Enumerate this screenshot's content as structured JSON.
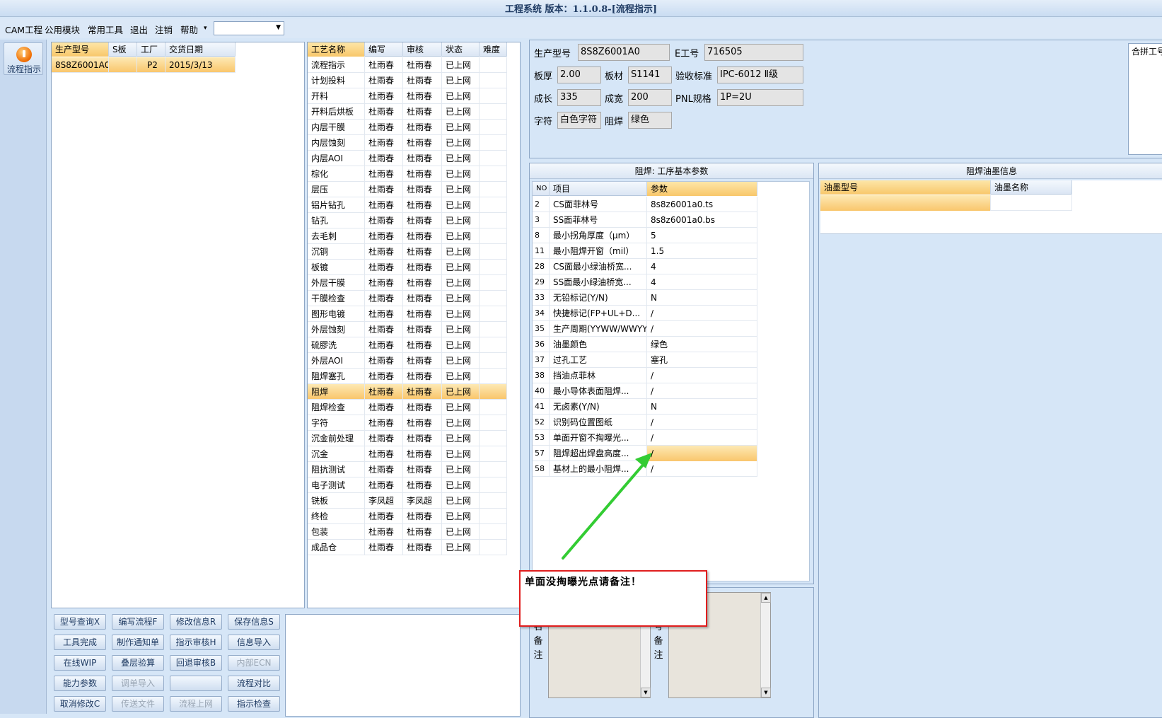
{
  "window": {
    "title": "工程系统 版本：1.1.0.8-[流程指示]"
  },
  "menu": {
    "items": [
      "CAM工程",
      "公用模块",
      "常用工具",
      "退出",
      "注销",
      "帮助",
      "▾"
    ],
    "combo_value": ""
  },
  "sidebar": {
    "flow_label": "流程指示"
  },
  "orders": {
    "headers": [
      "生产型号",
      "S板",
      "工厂",
      "交货日期"
    ],
    "rows": [
      {
        "model": "8S8Z6001A0",
        "s_board": "",
        "factory": "P2",
        "date": "2015/3/13"
      }
    ]
  },
  "processes": {
    "headers": [
      "工艺名称",
      "编写",
      "审核",
      "状态",
      "难度"
    ],
    "selected_index": 18,
    "rows": [
      [
        "流程指示",
        "杜雨春",
        "杜雨春",
        "已上网",
        ""
      ],
      [
        "计划投料",
        "杜雨春",
        "杜雨春",
        "已上网",
        ""
      ],
      [
        "开料",
        "杜雨春",
        "杜雨春",
        "已上网",
        ""
      ],
      [
        "开料后烘板",
        "杜雨春",
        "杜雨春",
        "已上网",
        ""
      ],
      [
        "内层干膜",
        "杜雨春",
        "杜雨春",
        "已上网",
        ""
      ],
      [
        "内层蚀刻",
        "杜雨春",
        "杜雨春",
        "已上网",
        ""
      ],
      [
        "内层AOI",
        "杜雨春",
        "杜雨春",
        "已上网",
        ""
      ],
      [
        "棕化",
        "杜雨春",
        "杜雨春",
        "已上网",
        ""
      ],
      [
        "层压",
        "杜雨春",
        "杜雨春",
        "已上网",
        ""
      ],
      [
        "铝片钻孔",
        "杜雨春",
        "杜雨春",
        "已上网",
        ""
      ],
      [
        "钻孔",
        "杜雨春",
        "杜雨春",
        "已上网",
        ""
      ],
      [
        "去毛刺",
        "杜雨春",
        "杜雨春",
        "已上网",
        ""
      ],
      [
        "沉铜",
        "杜雨春",
        "杜雨春",
        "已上网",
        ""
      ],
      [
        "板镀",
        "杜雨春",
        "杜雨春",
        "已上网",
        ""
      ],
      [
        "外层干膜",
        "杜雨春",
        "杜雨春",
        "已上网",
        ""
      ],
      [
        "干膜检查",
        "杜雨春",
        "杜雨春",
        "已上网",
        ""
      ],
      [
        "图形电镀",
        "杜雨春",
        "杜雨春",
        "已上网",
        ""
      ],
      [
        "外层蚀刻",
        "杜雨春",
        "杜雨春",
        "已上网",
        ""
      ],
      [
        "硫膠洗",
        "杜雨春",
        "杜雨春",
        "已上网",
        ""
      ],
      [
        "外层AOI",
        "杜雨春",
        "杜雨春",
        "已上网",
        ""
      ],
      [
        "阻焊塞孔",
        "杜雨春",
        "杜雨春",
        "已上网",
        ""
      ],
      [
        "阻焊",
        "杜雨春",
        "杜雨春",
        "已上网",
        ""
      ],
      [
        "阻焊检查",
        "杜雨春",
        "杜雨春",
        "已上网",
        ""
      ],
      [
        "字符",
        "杜雨春",
        "杜雨春",
        "已上网",
        ""
      ],
      [
        "沉金前处理",
        "杜雨春",
        "杜雨春",
        "已上网",
        ""
      ],
      [
        "沉金",
        "杜雨春",
        "杜雨春",
        "已上网",
        ""
      ],
      [
        "阻抗测试",
        "杜雨春",
        "杜雨春",
        "已上网",
        ""
      ],
      [
        "电子测试",
        "杜雨春",
        "杜雨春",
        "已上网",
        ""
      ],
      [
        "铣板",
        "李凤超",
        "李凤超",
        "已上网",
        ""
      ],
      [
        "终检",
        "杜雨春",
        "杜雨春",
        "已上网",
        ""
      ],
      [
        "包装",
        "杜雨春",
        "杜雨春",
        "已上网",
        ""
      ],
      [
        "成品仓",
        "杜雨春",
        "杜雨春",
        "已上网",
        ""
      ]
    ]
  },
  "info": {
    "model_label": "生产型号",
    "model_value": "8S8Z6001A0",
    "eno_label": "E工号",
    "eno_value": "716505",
    "thick_label": "板厚",
    "thick_value": "2.00",
    "material_label": "板材",
    "material_value": "S1141",
    "std_label": "验收标准",
    "std_value": "IPC-6012 Ⅱ级",
    "len_label": "成长",
    "len_value": "335",
    "width_label": "成宽",
    "width_value": "200",
    "pnl_label": "PNL规格",
    "pnl_value": "1P=2U",
    "char_label": "字符",
    "char_value": "白色字符",
    "mask_label": "阻焊",
    "mask_value": "绿色",
    "merge_label": "合拼工号"
  },
  "params": {
    "title": "阻焊: 工序基本参数",
    "headers": [
      "NO",
      "项目",
      "参数"
    ],
    "rows": [
      [
        "2",
        "CS面菲林号",
        "8s8z6001a0.ts"
      ],
      [
        "3",
        "SS面菲林号",
        "8s8z6001a0.bs"
      ],
      [
        "8",
        "最小拐角厚度（μm）",
        "5"
      ],
      [
        "11",
        "最小阻焊开窗（mil）",
        "1.5"
      ],
      [
        "28",
        "CS面最小绿油桥宽...",
        "4"
      ],
      [
        "29",
        "SS面最小绿油桥宽...",
        "4"
      ],
      [
        "33",
        "无铅标记(Y/N)",
        "N"
      ],
      [
        "34",
        "快捷标记(FP+UL+D...",
        "/"
      ],
      [
        "35",
        "生产周期(YYWW/WWYY)",
        "/"
      ],
      [
        "36",
        "油墨颜色",
        "绿色"
      ],
      [
        "37",
        "过孔工艺",
        "塞孔"
      ],
      [
        "38",
        "挡油点菲林",
        "/"
      ],
      [
        "40",
        "最小导体表面阻焊...",
        "/"
      ],
      [
        "41",
        "无卤素(Y/N)",
        "N"
      ],
      [
        "52",
        "识别码位置图纸",
        "/"
      ],
      [
        "53",
        "单面开窗不掏曝光...",
        "/"
      ],
      [
        "57",
        "阻焊超出焊盘高度...",
        "/"
      ],
      [
        "58",
        "基材上的最小阻焊...",
        "/"
      ]
    ],
    "selected_index": 16
  },
  "ink": {
    "title": "阻焊油墨信息",
    "headers": [
      "油墨型号",
      "油墨名称"
    ]
  },
  "buttons": [
    {
      "label": "型号查询X",
      "enabled": true
    },
    {
      "label": "编写流程F",
      "enabled": true
    },
    {
      "label": "修改信息R",
      "enabled": true
    },
    {
      "label": "保存信息S",
      "enabled": true
    },
    {
      "label": "工具完成",
      "enabled": true
    },
    {
      "label": "制作通知单",
      "enabled": true
    },
    {
      "label": "指示审核H",
      "enabled": true
    },
    {
      "label": "信息导入",
      "enabled": true
    },
    {
      "label": "在线WIP",
      "enabled": true
    },
    {
      "label": "叠层验算",
      "enabled": true
    },
    {
      "label": "回退审核B",
      "enabled": true
    },
    {
      "label": "内部ECN",
      "enabled": false
    },
    {
      "label": "能力参数",
      "enabled": true
    },
    {
      "label": "调单导入",
      "enabled": false
    },
    {
      "label": "",
      "enabled": false
    },
    {
      "label": "流程对比",
      "enabled": true
    },
    {
      "label": "取消修改C",
      "enabled": true
    },
    {
      "label": "传送文件",
      "enabled": false
    },
    {
      "label": "流程上网",
      "enabled": false
    },
    {
      "label": "指示检查",
      "enabled": true
    }
  ],
  "popup": {
    "text": "单面没掏曝光点请备注！"
  },
  "memo": {
    "left_label": "备注",
    "right_label": "备注",
    "left_prefix": "名",
    "right_prefix": "号"
  },
  "colors": {
    "highlight": "#f9c66c",
    "annotation_arrow": "#33cc33",
    "popup_border": "#e01e1e"
  }
}
